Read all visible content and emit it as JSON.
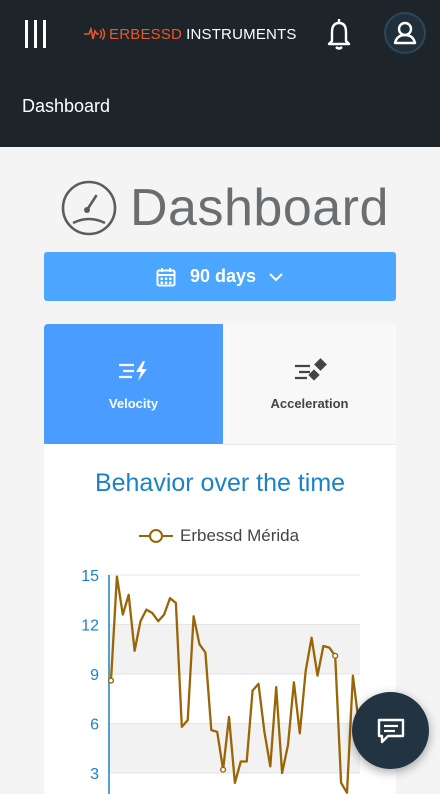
{
  "header": {
    "brand_name": "ERBESSD",
    "brand_suffix": "INSTRUMENTS",
    "icons": [
      "hamburger-icon",
      "bell-icon",
      "user-icon"
    ]
  },
  "subheader": {
    "title": "Dashboard"
  },
  "page": {
    "title": "Dashboard",
    "icon": "gauge-icon"
  },
  "range_selector": {
    "label": "90 days",
    "icons": [
      "calendar-icon",
      "chevron-down-icon"
    ]
  },
  "tabs": [
    {
      "label": "Velocity",
      "active": true,
      "icon": "velocity-icon"
    },
    {
      "label": "Acceleration",
      "active": false,
      "icon": "acceleration-icon"
    }
  ],
  "colors": {
    "accent": "#4a9dff",
    "header_bg": "#1d252b",
    "series": "#9a6506",
    "brand": "#e5572c"
  },
  "chart_data": {
    "type": "line",
    "title": "Behavior over the time",
    "legend_position": "top",
    "grid": true,
    "ylim": [
      2,
      15
    ],
    "y_ticks": [
      15,
      12,
      9,
      6,
      3
    ],
    "series": [
      {
        "name": "Erbessd Mérida",
        "values": [
          8.6,
          14.9,
          12.6,
          13.8,
          10.4,
          12.2,
          12.9,
          12.7,
          12.2,
          12.6,
          13.6,
          13.3,
          5.8,
          6.2,
          12.5,
          10.8,
          10.3,
          5.6,
          5.5,
          3.2,
          6.4,
          2.4,
          3.7,
          3.7,
          8.0,
          8.4,
          5.5,
          3.4,
          8.2,
          3.0,
          4.7,
          8.5,
          5.4,
          9.2,
          11.2,
          8.9,
          10.7,
          10.6,
          10.1,
          2.4,
          1.8,
          8.9,
          6.0
        ]
      }
    ],
    "markers_shown_at": [
      0,
      19,
      38
    ]
  },
  "chat_button": {
    "icon": "chat-icon"
  }
}
